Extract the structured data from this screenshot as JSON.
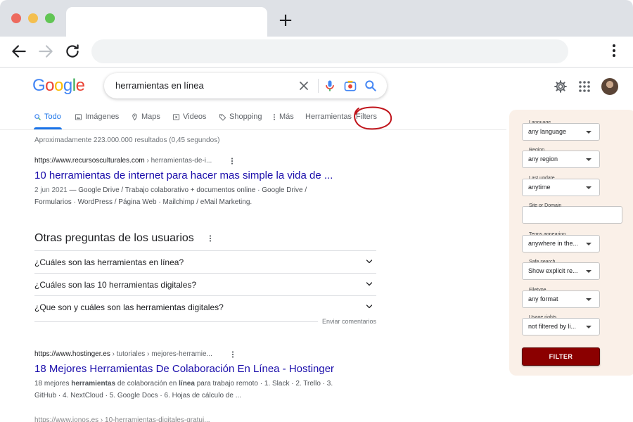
{
  "browser": {
    "address_value": "",
    "new_tab_glyph": "+"
  },
  "search": {
    "query": "herramientas en línea",
    "logo": [
      "G",
      "o",
      "o",
      "g",
      "l",
      "e"
    ],
    "logo_colors": [
      "#4285f4",
      "#ea4335",
      "#fbbc05",
      "#4285f4",
      "#34a853",
      "#ea4335"
    ]
  },
  "tabs": [
    {
      "label": "Todo",
      "icon": "search-icon"
    },
    {
      "label": "Imágenes",
      "icon": "image-icon"
    },
    {
      "label": "Maps",
      "icon": "map-pin-icon"
    },
    {
      "label": "Videos",
      "icon": "play-icon"
    },
    {
      "label": "Shopping",
      "icon": "tag-icon"
    },
    {
      "label": "Más",
      "icon": "more-vert-icon"
    },
    {
      "label": "Herramientas"
    },
    {
      "label": "Filters"
    }
  ],
  "stats": "Aproximadamente 223.000.000 resultados (0,45 segundos)",
  "results": [
    {
      "domain": "https://www.recursosculturales.com",
      "path": " › herramientas-de-i...",
      "title": "10 herramientas de internet para hacer mas simple la vida de ...",
      "date": "2 jun 2021",
      "snippet_line1": " — Google Drive / Trabajo colaborativo + documentos online · Google Drive /",
      "snippet_line2": "Formularios · WordPress / Página Web · Mailchimp / eMail Marketing."
    },
    {
      "domain": "https://www.hostinger.es",
      "path": " › tutoriales › mejores-herramie...",
      "title": "18 Mejores Herramientas De Colaboración En Línea - Hostinger",
      "snippet_a": "18 mejores ",
      "snippet_b": "herramientas",
      "snippet_c": " de colaboración en ",
      "snippet_d": "línea",
      "snippet_e": " para trabajo remoto · 1. Slack · 2. Trello · 3.",
      "snippet_line2": "GitHub · 4. NextCloud · 5. Google Docs · 6. Hojas de cálculo de ..."
    }
  ],
  "paa": {
    "title": "Otras preguntas de los usuarios",
    "questions": [
      "¿Cuáles son las herramientas en línea?",
      "¿Cuáles son las 10 herramientas digitales?",
      "¿Que son y cuáles son las herramientas digitales?"
    ],
    "feedback": "Enviar comentarios"
  },
  "filters": {
    "fields": [
      {
        "label": "Language",
        "value": "any language"
      },
      {
        "label": "Region",
        "value": "any region"
      },
      {
        "label": "Last update",
        "value": "anytime"
      },
      {
        "label": "Site or Domain",
        "value": ""
      },
      {
        "label": "Terms appearing",
        "value": "anywhere in the..."
      },
      {
        "label": "Safe search",
        "value": "Show explicit re..."
      },
      {
        "label": "Filetype",
        "value": "any format"
      },
      {
        "label": "Usage rights",
        "value": "not filtered by li..."
      }
    ],
    "button": "FILTER",
    "accent": "#8b0000"
  },
  "cutoff_text": "https://www.ionos.es › 10-herramientas-digitales-gratui..."
}
